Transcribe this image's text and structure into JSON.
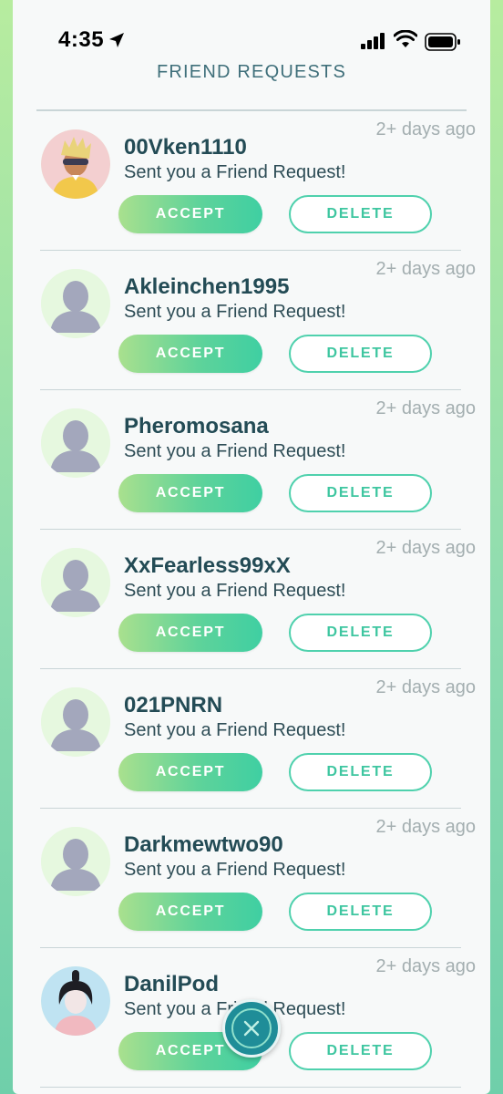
{
  "status_bar": {
    "time": "4:35",
    "icons": [
      "location-arrow-icon",
      "signal-icon",
      "wifi-icon",
      "battery-icon"
    ]
  },
  "header": {
    "title": "FRIEND REQUESTS"
  },
  "requests": [
    {
      "name": "00Vken1110",
      "message": "Sent you a Friend Request!",
      "time_ago": "2+ days ago",
      "accept_label": "ACCEPT",
      "delete_label": "DELETE",
      "avatar": "custom-trainer-blond"
    },
    {
      "name": "Akleinchen1995",
      "message": "Sent you a Friend Request!",
      "time_ago": "2+ days ago",
      "accept_label": "ACCEPT",
      "delete_label": "DELETE",
      "avatar": "default-silhouette"
    },
    {
      "name": "Pheromosana",
      "message": "Sent you a Friend Request!",
      "time_ago": "2+ days ago",
      "accept_label": "ACCEPT",
      "delete_label": "DELETE",
      "avatar": "default-silhouette"
    },
    {
      "name": "XxFearless99xX",
      "message": "Sent you a Friend Request!",
      "time_ago": "2+ days ago",
      "accept_label": "ACCEPT",
      "delete_label": "DELETE",
      "avatar": "default-silhouette"
    },
    {
      "name": "021PNRN",
      "message": "Sent you a Friend Request!",
      "time_ago": "2+ days ago",
      "accept_label": "ACCEPT",
      "delete_label": "DELETE",
      "avatar": "default-silhouette"
    },
    {
      "name": "Darkmewtwo90",
      "message": "Sent you a Friend Request!",
      "time_ago": "2+ days ago",
      "accept_label": "ACCEPT",
      "delete_label": "DELETE",
      "avatar": "default-silhouette"
    },
    {
      "name": "DanilPod",
      "message": "Sent you a Friend Request!",
      "time_ago": "2+ days ago",
      "accept_label": "ACCEPT",
      "delete_label": "DELETE",
      "avatar": "custom-trainer-dark"
    }
  ],
  "close_button": {
    "icon": "close-icon"
  },
  "colors": {
    "accent": "#3fcfa2",
    "title": "#3f6f7a",
    "name_text": "#234b55",
    "time_ago": "#a3aeb0",
    "fab": "#1f8d98"
  }
}
